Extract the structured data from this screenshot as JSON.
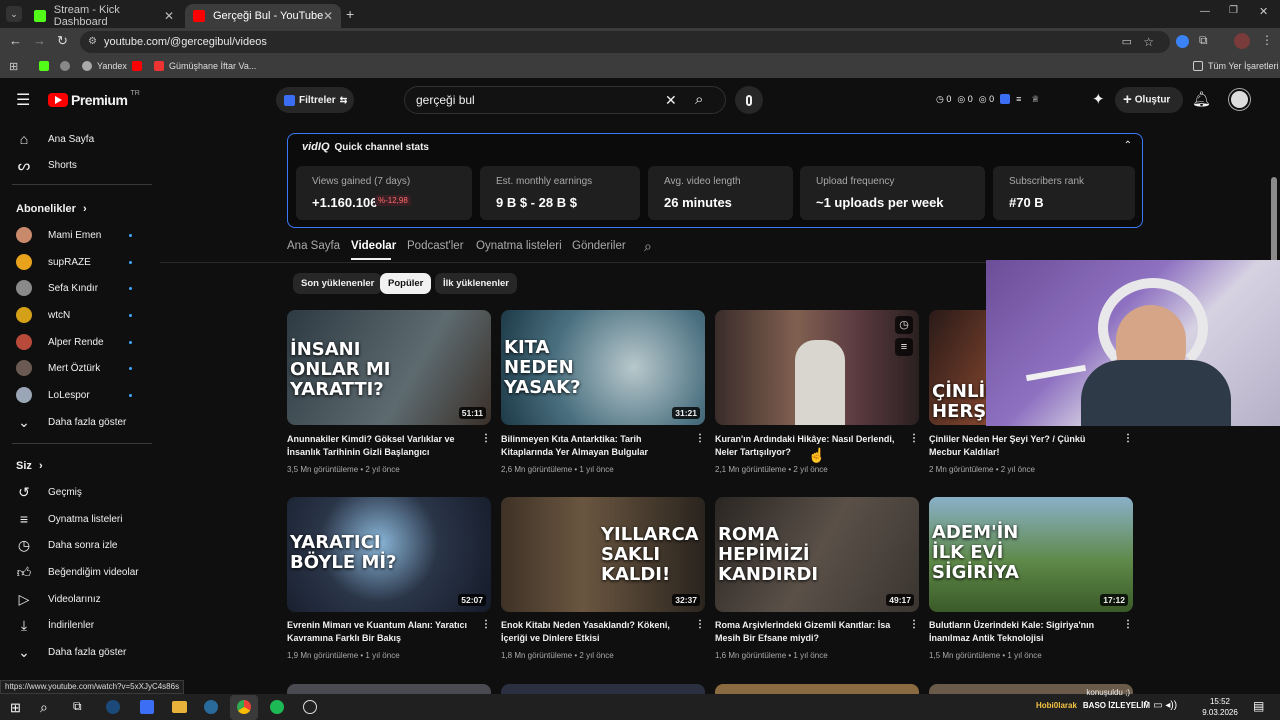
{
  "browser": {
    "tabs": [
      {
        "title": "Stream - Kick Dashboard",
        "active": false,
        "favicon_color": "#53fc18"
      },
      {
        "title": "Gerçeği Bul - YouTube",
        "active": true,
        "favicon_color": "#ff0000"
      }
    ],
    "url": "youtube.com/@gercegibul/videos",
    "bookmarks": [
      {
        "label": "",
        "icon": "kick-icon",
        "color": "#53fc18"
      },
      {
        "label": "",
        "icon": "globe-icon",
        "color": "#bbbbbb"
      },
      {
        "label": "Yandex",
        "icon": "yandex-icon",
        "color": "#cccccc"
      },
      {
        "label": "",
        "icon": "youtube-icon",
        "color": "#ff0000"
      },
      {
        "label": "Gümüşhane İftar Va...",
        "icon": "h-icon",
        "color": "#e33"
      }
    ],
    "all_bookmarks": "Tüm Yer İşaretleri"
  },
  "youtube": {
    "logo": "Premium",
    "logo_sup": "TR",
    "filters_label": "Filtreler",
    "search_value": "gerçeği bul",
    "header_counts": [
      "0",
      "0",
      "0"
    ],
    "create_label": "Oluştur"
  },
  "sidebar": {
    "main": [
      {
        "label": "Ana Sayfa",
        "icon": "home-icon"
      },
      {
        "label": "Shorts",
        "icon": "shorts-icon"
      }
    ],
    "subs_heading": "Abonelikler",
    "subs": [
      {
        "label": "Mami Emen",
        "color": "#c98a6b"
      },
      {
        "label": "supRAZE",
        "color": "#e8a21b"
      },
      {
        "label": "Sefa Kındır",
        "color": "#8a8a8a"
      },
      {
        "label": "wtcN",
        "color": "#d4a017"
      },
      {
        "label": "Alper Rende",
        "color": "#b84a3a"
      },
      {
        "label": "Mert Öztürk",
        "color": "#6b5a52"
      },
      {
        "label": "LoLespor",
        "color": "#9aa5b5"
      }
    ],
    "show_more": "Daha fazla göster",
    "you_heading": "Siz",
    "you": [
      {
        "label": "Geçmiş",
        "icon": "history-icon"
      },
      {
        "label": "Oynatma listeleri",
        "icon": "playlist-icon"
      },
      {
        "label": "Daha sonra izle",
        "icon": "clock-icon"
      },
      {
        "label": "Beğendiğim videolar",
        "icon": "like-icon"
      },
      {
        "label": "Videolarınız",
        "icon": "video-icon"
      },
      {
        "label": "İndirilenler",
        "icon": "download-icon"
      }
    ],
    "show_more_2": "Daha fazla göster"
  },
  "vidiq": {
    "brand": "vidIQ",
    "title": "Quick channel stats",
    "stats": [
      {
        "label": "Views gained (7 days)",
        "value": "+1.160.106",
        "badge": "%-12,98"
      },
      {
        "label": "Est. monthly earnings",
        "value": "9 B $ - 28 B $"
      },
      {
        "label": "Avg. video length",
        "value": "26 minutes"
      },
      {
        "label": "Upload frequency",
        "value": "~1 uploads per week"
      },
      {
        "label": "Subscribers rank",
        "value": "#70 B"
      }
    ]
  },
  "channel_tabs": [
    "Ana Sayfa",
    "Videolar",
    "Podcast'ler",
    "Oynatma listeleri",
    "Gönderiler"
  ],
  "active_tab": "Videolar",
  "chips": [
    "Son yüklenenler",
    "Popüler",
    "İlk yüklenenler"
  ],
  "active_chip": "Popüler",
  "videos": [
    {
      "thumb_text": "İNSANI\nONLAR MI\nYARATTI?",
      "duration": "51:11",
      "title": "Anunnakiler Kimdi? Göksel Varlıklar ve İnsanlık Tarihinin Gizli Başlangıcı",
      "meta": "3,5 Mn görüntüleme • 2 yıl önce",
      "bg": "#3d4a52"
    },
    {
      "thumb_text": "KITA\nNEDEN\nYASAK?",
      "duration": "31:21",
      "title": "Bilinmeyen Kıta Antarktika: Tarih Kitaplarında Yer Almayan Bulgular",
      "meta": "2,6 Mn görüntüleme • 1 yıl önce",
      "bg": "#4a7080"
    },
    {
      "thumb_text": "",
      "duration": "",
      "title": "Kuran'ın Ardındaki Hikâye: Nasıl Derlendi, Neler Tartışılıyor?",
      "meta": "2,1 Mn görüntüleme • 2 yıl önce",
      "bg": "#5a4540"
    },
    {
      "thumb_text": "ÇİNLİL\nHERŞE",
      "duration": "",
      "title": "Çinliler Neden Her Şeyi Yer? / Çünkü Mecbur Kaldılar!",
      "meta": "2 Mn görüntüleme • 2 yıl önce",
      "bg": "#6a3a2a"
    },
    {
      "thumb_text": "YARATICI\nBÖYLE Mİ?",
      "duration": "52:07",
      "title": "Evrenin Mimarı ve Kuantum Alanı: Yaratıcı Kavramına Farklı Bir Bakış",
      "meta": "1,9 Mn görüntüleme • 1 yıl önce",
      "bg": "#2a3548"
    },
    {
      "thumb_text": "YILLARCA\nSAKLI\nKALDI!",
      "duration": "32:37",
      "title": "Enok Kitabı Neden Yasaklandı? Kökeni, İçeriği ve Dinlere Etkisi",
      "meta": "1,8 Mn görüntüleme • 2 yıl önce",
      "bg": "#3e3226"
    },
    {
      "thumb_text": "ROMA\nHEPİMİZİ\nKANDIRDI",
      "duration": "49:17",
      "title": "Roma Arşivlerindeki Gizemli Kanıtlar: İsa Mesih Bir Efsane miydi?",
      "meta": "1,6 Mn görüntüleme • 1 yıl önce",
      "bg": "#3a3530"
    },
    {
      "thumb_text": "ADEM'İN\nİLK EVİ\nSİGİRİYA",
      "duration": "17:12",
      "title": "Bulutların Üzerindeki Kale: Sigiriya'nın İnanılmaz Antik Teknolojisi",
      "meta": "1,5 Mn görüntüleme • 1 yıl önce",
      "bg": "#4f6a3a"
    }
  ],
  "status_url": "https://www.youtube.com/watch?v=5xXJyC4s86s",
  "taskbar": {
    "time": "15:52",
    "date": "9.03.2026",
    "chat_user": "Hobi0larak",
    "chat_text": "BASO İZLEYELİM",
    "chat_line2": "konuşuldu ;)"
  }
}
